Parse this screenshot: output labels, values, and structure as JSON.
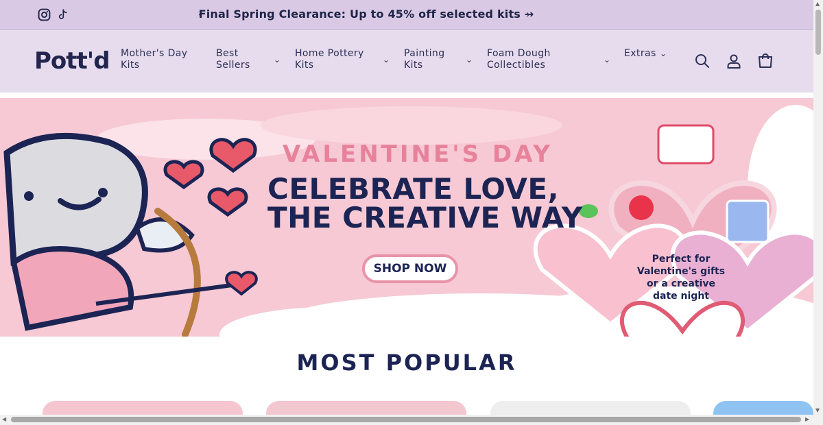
{
  "announcement": {
    "text": "Final Spring Clearance: Up to 45% off selected kits →",
    "prev": "‹",
    "next": "›"
  },
  "brand": {
    "logo": "Pott'd"
  },
  "nav": [
    {
      "line1": "Mother's Day",
      "line2": "Kits"
    },
    {
      "line1": "Best",
      "line2": "Sellers"
    },
    {
      "line1": "Home Pottery",
      "line2": "Kits"
    },
    {
      "line1": "Painting",
      "line2": "Kits"
    },
    {
      "line1": "Foam Dough",
      "line2": "Collectibles"
    },
    {
      "line1": "Extras",
      "line2": ""
    }
  ],
  "hero": {
    "kicker": "VALENTINE'S DAY",
    "headline1": "CELEBRATE LOVE,",
    "headline2": "THE CREATIVE WAY",
    "cta": "SHOP NOW",
    "heart_note_1": "Perfect for",
    "heart_note_2": "Valentine's gifts",
    "heart_note_3": "or a creative",
    "heart_note_4": "date night"
  },
  "section": {
    "title": "MOST POPULAR"
  },
  "colors": {
    "announcement_bg": "#d9c9e4",
    "header_bg": "#e7dcee",
    "hero_bg": "#f6c9d4",
    "navy": "#1c2454",
    "pink_accent": "#e7829a"
  }
}
